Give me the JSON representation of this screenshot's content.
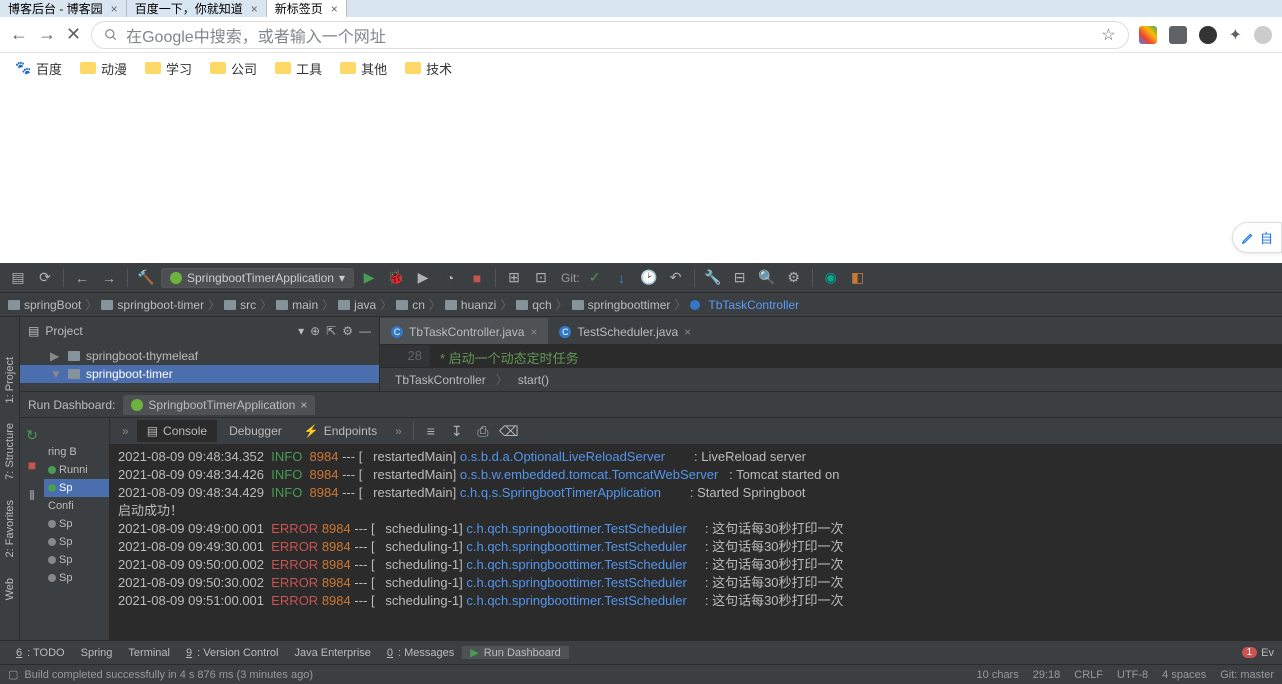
{
  "browser": {
    "tabs": [
      {
        "title": "博客后台 - 博客园"
      },
      {
        "title": "百度一下，你就知道"
      },
      {
        "title": "新标签页"
      }
    ],
    "omnibox_placeholder": "在Google中搜索，或者输入一个网址",
    "bookmarks": [
      "百度",
      "动漫",
      "学习",
      "公司",
      "工具",
      "其他",
      "技术"
    ],
    "edit_label": "自"
  },
  "ide": {
    "run_config": "SpringbootTimerApplication",
    "git_label": "Git:",
    "breadcrumbs": [
      "springBoot",
      "springboot-timer",
      "src",
      "main",
      "java",
      "cn",
      "huanzi",
      "qch",
      "springboottimer",
      "TbTaskController"
    ],
    "project_label": "Project",
    "tree": [
      {
        "label": "springboot-thymeleaf",
        "arrow": "▶"
      },
      {
        "label": "springboot-timer",
        "arrow": "▼",
        "selected": true
      }
    ],
    "editor_tabs": [
      {
        "label": "TbTaskController.java",
        "active": true
      },
      {
        "label": "TestScheduler.java",
        "active": false
      }
    ],
    "gutter_line": "28",
    "code_comment": "*  启动一个动态定时任务",
    "editor_bc": [
      "TbTaskController",
      "start()"
    ],
    "rd_title": "Run Dashboard:",
    "rd_tab": "SpringbootTimerApplication",
    "console_tabs": [
      "Console",
      "Debugger",
      "Endpoints"
    ],
    "rd_tree": [
      {
        "label": "ring B",
        "dot": ""
      },
      {
        "label": "Runni",
        "dot": "g"
      },
      {
        "label": "Sp",
        "dot": "g",
        "sel": true
      },
      {
        "label": "Confi",
        "dot": ""
      },
      {
        "label": "Sp",
        "dot": "gr"
      },
      {
        "label": "Sp",
        "dot": "gr"
      },
      {
        "label": "Sp",
        "dot": "gr"
      },
      {
        "label": "Sp",
        "dot": "gr"
      }
    ],
    "log_lines": [
      {
        "ts": "2021-08-09 09:48:34.352",
        "lvl": "INFO",
        "pid": "8984",
        "thread": "restartedMain",
        "logger": "o.s.b.d.a.OptionalLiveReloadServer",
        "msg": "LiveReload server"
      },
      {
        "ts": "2021-08-09 09:48:34.426",
        "lvl": "INFO",
        "pid": "8984",
        "thread": "restartedMain",
        "logger": "o.s.b.w.embedded.tomcat.TomcatWebServer",
        "msg": "Tomcat started on"
      },
      {
        "ts": "2021-08-09 09:48:34.429",
        "lvl": "INFO",
        "pid": "8984",
        "thread": "restartedMain",
        "logger": "c.h.q.s.SpringbootTimerApplication",
        "msg": "Started Springboot"
      },
      {
        "raw": "启动成功！"
      },
      {
        "ts": "2021-08-09 09:49:00.001",
        "lvl": "ERROR",
        "pid": "8984",
        "thread": "scheduling-1",
        "logger": "c.h.qch.springboottimer.TestScheduler",
        "msg": "这句话每30秒打印一次"
      },
      {
        "ts": "2021-08-09 09:49:30.001",
        "lvl": "ERROR",
        "pid": "8984",
        "thread": "scheduling-1",
        "logger": "c.h.qch.springboottimer.TestScheduler",
        "msg": "这句话每30秒打印一次"
      },
      {
        "ts": "2021-08-09 09:50:00.002",
        "lvl": "ERROR",
        "pid": "8984",
        "thread": "scheduling-1",
        "logger": "c.h.qch.springboottimer.TestScheduler",
        "msg": "这句话每30秒打印一次"
      },
      {
        "ts": "2021-08-09 09:50:30.002",
        "lvl": "ERROR",
        "pid": "8984",
        "thread": "scheduling-1",
        "logger": "c.h.qch.springboottimer.TestScheduler",
        "msg": "这句话每30秒打印一次"
      },
      {
        "ts": "2021-08-09 09:51:00.001",
        "lvl": "ERROR",
        "pid": "8984",
        "thread": "scheduling-1",
        "logger": "c.h.qch.springboottimer.TestScheduler",
        "msg": "这句话每30秒打印一次"
      }
    ],
    "footer": [
      {
        "label": "6: TODO",
        "u": true
      },
      {
        "label": "Spring"
      },
      {
        "label": "Terminal"
      },
      {
        "label": "9: Version Control",
        "u": true
      },
      {
        "label": "Java Enterprise"
      },
      {
        "label": "0: Messages",
        "u": true
      },
      {
        "label": "Run Dashboard",
        "active": true,
        "play": true
      }
    ],
    "footer_err": "1",
    "footer_ev": "Ev",
    "status_left": "Build completed successfully in 4 s 876 ms (3 minutes ago)",
    "status_right": [
      "10 chars",
      "29:18",
      "CRLF",
      "UTF-8",
      "4 spaces",
      "Git: master"
    ]
  }
}
